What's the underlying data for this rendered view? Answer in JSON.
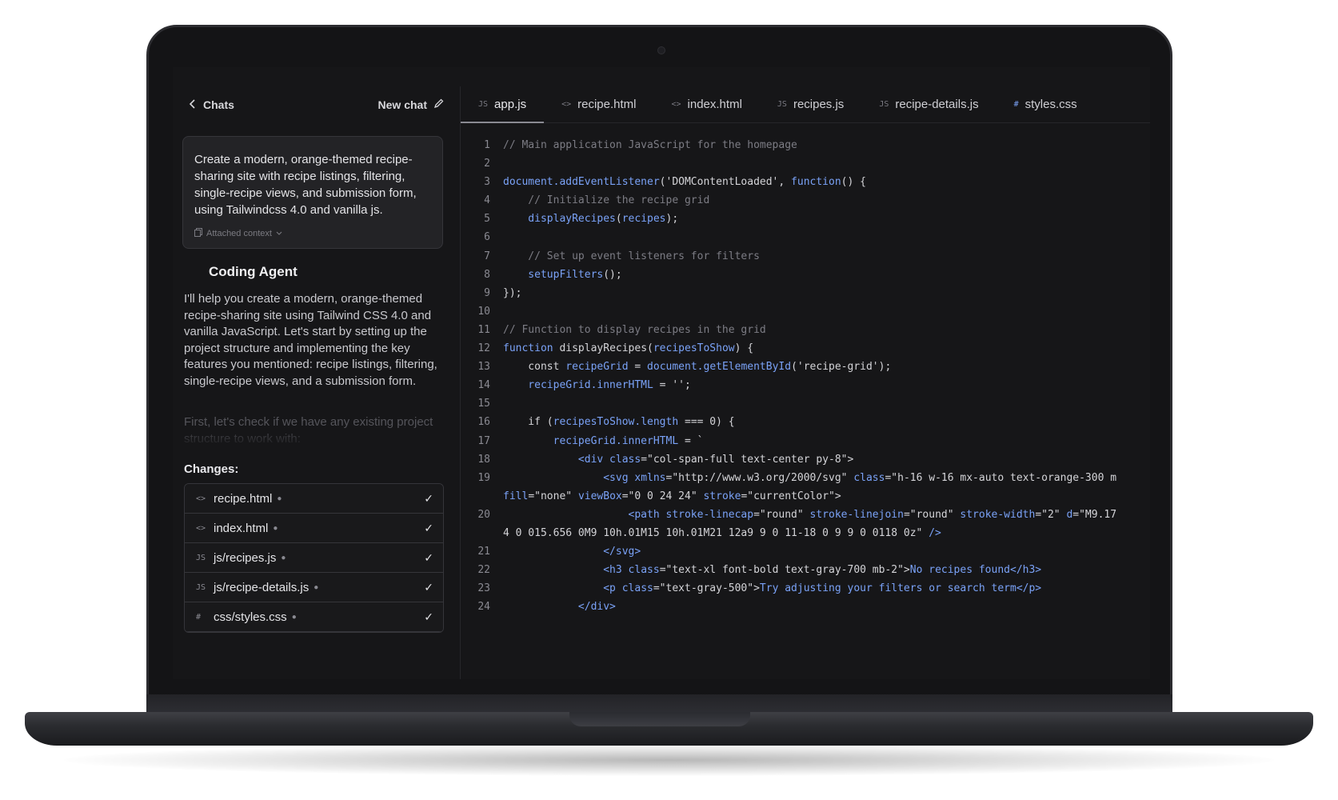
{
  "chat_panel": {
    "back_label": "Chats",
    "new_chat_label": "New chat",
    "prompt": "Create a modern, orange-themed recipe-sharing site with recipe listings, filtering, single-recipe views, and submission form, using Tailwindcss 4.0 and vanilla js.",
    "attached_context_label": "Attached context",
    "agent_name": "Coding Agent",
    "agent_message": "I'll help you create a modern, orange-themed recipe-sharing site using Tailwind CSS 4.0 and vanilla JavaScript. Let's start by setting up the project structure and implementing the key features you mentioned: recipe listings, filtering, single-recipe views, and a submission form.",
    "agent_message_faded": "First, let's check if we have any existing project structure to work with:",
    "changes_label": "Changes:",
    "changes": [
      {
        "icon": "<>",
        "name": "recipe.html"
      },
      {
        "icon": "<>",
        "name": "index.html"
      },
      {
        "icon": "JS",
        "name": "js/recipes.js"
      },
      {
        "icon": "JS",
        "name": "js/recipe-details.js"
      },
      {
        "icon": "#",
        "name": "css/styles.css"
      }
    ]
  },
  "editor": {
    "tabs": [
      {
        "icon": "JS",
        "label": "app.js",
        "active": true
      },
      {
        "icon": "<>",
        "label": "recipe.html",
        "active": false
      },
      {
        "icon": "<>",
        "label": "index.html",
        "active": false
      },
      {
        "icon": "JS",
        "label": "recipes.js",
        "active": false
      },
      {
        "icon": "JS",
        "label": "recipe-details.js",
        "active": false
      },
      {
        "icon": "#",
        "label": "styles.css",
        "active": false
      }
    ],
    "lines": [
      {
        "n": "1",
        "parts": [
          [
            "cm",
            "// Main application JavaScript for the homepage"
          ]
        ]
      },
      {
        "n": "2",
        "parts": []
      },
      {
        "n": "3",
        "parts": [
          [
            "fn",
            "document.addEventListener"
          ],
          [
            "lc",
            "('DOMContentLoaded', "
          ],
          [
            "kw",
            "function"
          ],
          [
            "lc",
            "() {"
          ]
        ]
      },
      {
        "n": "4",
        "parts": [
          [
            "cm",
            "    // Initialize the recipe grid"
          ]
        ]
      },
      {
        "n": "5",
        "parts": [
          [
            "fn",
            "    displayRecipes"
          ],
          [
            "lc",
            "("
          ],
          [
            "fn",
            "recipes"
          ],
          [
            "lc",
            ");"
          ]
        ]
      },
      {
        "n": "6",
        "parts": []
      },
      {
        "n": "7",
        "parts": [
          [
            "cm",
            "    // Set up event listeners for filters"
          ]
        ]
      },
      {
        "n": "8",
        "parts": [
          [
            "fn",
            "    setupFilters"
          ],
          [
            "lc",
            "();"
          ]
        ]
      },
      {
        "n": "9",
        "parts": [
          [
            "lc",
            "});"
          ]
        ]
      },
      {
        "n": "10",
        "parts": []
      },
      {
        "n": "11",
        "parts": [
          [
            "cm",
            "// Function to display recipes in the grid"
          ]
        ]
      },
      {
        "n": "12",
        "parts": [
          [
            "kw",
            "function"
          ],
          [
            "lc",
            " displayRecipes("
          ],
          [
            "fn",
            "recipesToShow"
          ],
          [
            "lc",
            ") {"
          ]
        ]
      },
      {
        "n": "13",
        "parts": [
          [
            "lc",
            "    const "
          ],
          [
            "fn",
            "recipeGrid"
          ],
          [
            "lc",
            " = "
          ],
          [
            "fn",
            "document.getElementById"
          ],
          [
            "lc",
            "('recipe-grid');"
          ]
        ]
      },
      {
        "n": "14",
        "parts": [
          [
            "fn",
            "    recipeGrid.innerHTML"
          ],
          [
            "lc",
            " = '';"
          ]
        ]
      },
      {
        "n": "15",
        "parts": []
      },
      {
        "n": "16",
        "parts": [
          [
            "lc",
            "    if ("
          ],
          [
            "fn",
            "recipesToShow.length"
          ],
          [
            "lc",
            " === 0) {"
          ]
        ]
      },
      {
        "n": "17",
        "parts": [
          [
            "fn",
            "        recipeGrid.innerHTML"
          ],
          [
            "lc",
            " = `"
          ]
        ]
      },
      {
        "n": "18",
        "parts": [
          [
            "tg",
            "            <div"
          ],
          [
            "at",
            " class"
          ],
          [
            "lc",
            "=\"col-span-full text-center py-8\">"
          ]
        ]
      },
      {
        "n": "19",
        "parts": [
          [
            "tg",
            "                <svg"
          ],
          [
            "at",
            " xmlns"
          ],
          [
            "lc",
            "=\"http://www.w3.org/2000/svg\" "
          ],
          [
            "at",
            "class"
          ],
          [
            "lc",
            "=\"h-16 w-16 mx-auto text-orange-300 m"
          ]
        ]
      },
      {
        "n": "",
        "parts": [
          [
            "at",
            "fill"
          ],
          [
            "lc",
            "=\"none\" "
          ],
          [
            "at",
            "viewBox"
          ],
          [
            "lc",
            "=\"0 0 24 24\" "
          ],
          [
            "at",
            "stroke"
          ],
          [
            "lc",
            "=\"currentColor\">"
          ]
        ]
      },
      {
        "n": "20",
        "parts": [
          [
            "tg",
            "                    <path"
          ],
          [
            "at",
            " stroke-linecap"
          ],
          [
            "lc",
            "=\"round\" "
          ],
          [
            "at",
            "stroke-linejoin"
          ],
          [
            "lc",
            "=\"round\" "
          ],
          [
            "at",
            "stroke-width"
          ],
          [
            "lc",
            "=\"2\" "
          ],
          [
            "at",
            "d"
          ],
          [
            "lc",
            "=\"M9.17"
          ]
        ]
      },
      {
        "n": "",
        "parts": [
          [
            "lc",
            "4 0 015.656 0M9 10h.01M15 10h.01M21 12a9 9 0 11-18 0 9 9 0 0118 0z\" "
          ],
          [
            "tg",
            "/>"
          ]
        ]
      },
      {
        "n": "21",
        "parts": [
          [
            "tg",
            "                </svg>"
          ]
        ]
      },
      {
        "n": "22",
        "parts": [
          [
            "tg",
            "                <h3"
          ],
          [
            "at",
            " class"
          ],
          [
            "lc",
            "=\"text-xl font-bold text-gray-700 mb-2\">"
          ],
          [
            "kw",
            "No recipes found"
          ],
          [
            "tg",
            "</h3>"
          ]
        ]
      },
      {
        "n": "23",
        "parts": [
          [
            "tg",
            "                <p"
          ],
          [
            "at",
            " class"
          ],
          [
            "lc",
            "=\"text-gray-500\">"
          ],
          [
            "kw",
            "Try adjusting your filters or search term"
          ],
          [
            "tg",
            "</p>"
          ]
        ]
      },
      {
        "n": "24",
        "parts": [
          [
            "tg",
            "            </div>"
          ]
        ]
      }
    ]
  }
}
